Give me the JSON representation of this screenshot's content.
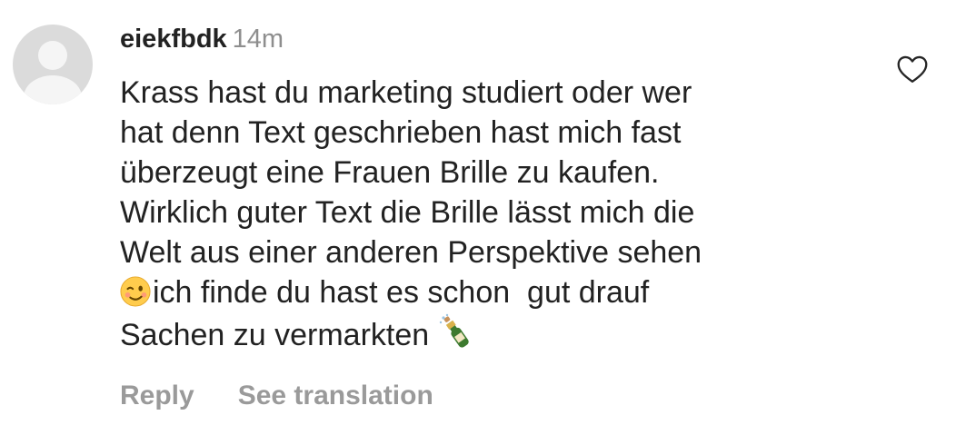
{
  "comment": {
    "username": "eiekfbdk",
    "timestamp": "14m",
    "lines": [
      "Krass hast du marketing studiert oder wer",
      "hat denn Text geschrieben hast mich fast",
      "überzeugt eine Frauen Brille zu kaufen.",
      "Wirklich guter Text die Brille lässt mich die",
      "Welt aus einer anderen Perspektive sehen",
      "ich finde du hast es schon  gut drauf",
      "Sachen zu vermarkten"
    ],
    "emojis": {
      "wink": "winking-face-emoji",
      "bottle": "bottle-with-popping-cork-emoji"
    }
  },
  "actions": {
    "reply_label": "Reply",
    "translate_label": "See translation"
  },
  "icons": {
    "like": "heart-icon",
    "avatar": "default-avatar-icon"
  },
  "colors": {
    "text": "#222222",
    "muted": "#8e8e8e",
    "action": "#9a9a9a",
    "avatar_bg": "#dbdbdb"
  }
}
